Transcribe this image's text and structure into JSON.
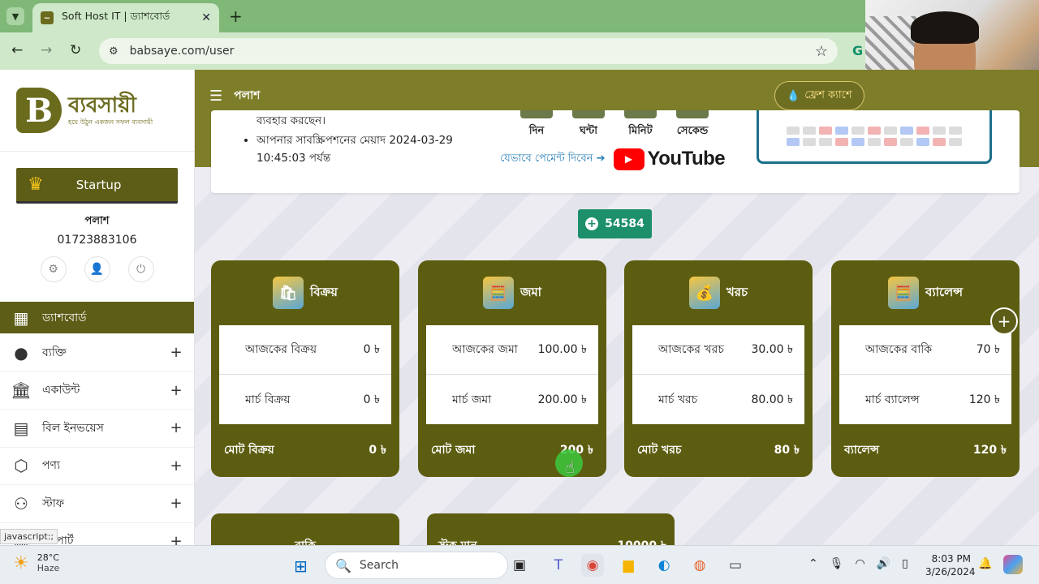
{
  "browser": {
    "tab_title": "Soft Host IT | ড্যাশবোর্ড",
    "url": "babsaye.com/user"
  },
  "brand": {
    "name": "ব্যবসায়ী",
    "tagline": "হয়ে উঠুন একজন সফল ব্যবসায়ী",
    "color": "#5d5d18"
  },
  "sidebar": {
    "plan": "Startup",
    "user_name": "পলাশ",
    "user_phone": "01723883106",
    "items": [
      {
        "label": "ড্যাশবোর্ড",
        "icon": "dashboard-icon",
        "glyph": "▦"
      },
      {
        "label": "ব্যক্তি",
        "icon": "person-icon",
        "glyph": "●"
      },
      {
        "label": "একাউন্ট",
        "icon": "bank-icon",
        "glyph": "🏛"
      },
      {
        "label": "বিল ইনভয়েস",
        "icon": "invoice-icon",
        "glyph": "▤"
      },
      {
        "label": "পণ্য",
        "icon": "box-icon",
        "glyph": "⬡"
      },
      {
        "label": "স্টাফ",
        "icon": "staff-icon",
        "glyph": "⚇"
      },
      {
        "label": "রিপোর্ট",
        "icon": "report-icon",
        "glyph": "▥"
      }
    ],
    "status_text": "javascript:;"
  },
  "header": {
    "title": "পলাশ",
    "fresh_cash": "ফ্রেশ ক্যাশে"
  },
  "info": {
    "line1": "ব্যবহার করছেন।",
    "line2": "আপনার সাবস্ক্রিপশনের মেয়াদ 2024-03-29 10:45:03 পর্যন্ত",
    "countdown_labels": [
      "দিন",
      "ঘন্টা",
      "মিনিট",
      "সেকেন্ড"
    ],
    "pay_link": "যেভাবে পেমেন্ট দিবেন ➔",
    "youtube": "YouTube"
  },
  "balance_button": "54584",
  "cards": [
    {
      "title": "বিক্রয়",
      "icon": "shopping-bag-icon",
      "glyph": "🛍",
      "rows": [
        {
          "label": "আজকের বিক্রয়",
          "value": "0 ৳"
        },
        {
          "label": "মার্চ বিক্রয়",
          "value": "0 ৳"
        }
      ],
      "foot_label": "মোট বিক্রয়",
      "foot_value": "0 ৳"
    },
    {
      "title": "জমা",
      "icon": "calculator-icon",
      "glyph": "🧮",
      "rows": [
        {
          "label": "আজকের জমা",
          "value": "100.00 ৳"
        },
        {
          "label": "মার্চ জমা",
          "value": "200.00 ৳"
        }
      ],
      "foot_label": "মোট জমা",
      "foot_value": "200 ৳"
    },
    {
      "title": "খরচ",
      "icon": "money-bag-icon",
      "glyph": "💰",
      "rows": [
        {
          "label": "আজকের খরচ",
          "value": "30.00 ৳"
        },
        {
          "label": "মার্চ খরচ",
          "value": "80.00 ৳"
        }
      ],
      "foot_label": "মোট খরচ",
      "foot_value": "80 ৳"
    },
    {
      "title": "ব্যালেন্স",
      "icon": "calculator-icon",
      "glyph": "🧮",
      "rows": [
        {
          "label": "আজকের বাকি",
          "value": "70 ৳"
        },
        {
          "label": "মার্চ ব্যালেন্স",
          "value": "120 ৳"
        }
      ],
      "foot_label": "ব্যালেন্স",
      "foot_value": "120 ৳"
    }
  ],
  "bottom_cards": [
    {
      "title": "বাকি",
      "value": ""
    },
    {
      "title": "স্টক মান",
      "value": "10000 ৳"
    }
  ],
  "taskbar": {
    "temp": "28°C",
    "weather": "Haze",
    "search": "Search",
    "time": "8:03 PM",
    "date": "3/26/2024"
  }
}
